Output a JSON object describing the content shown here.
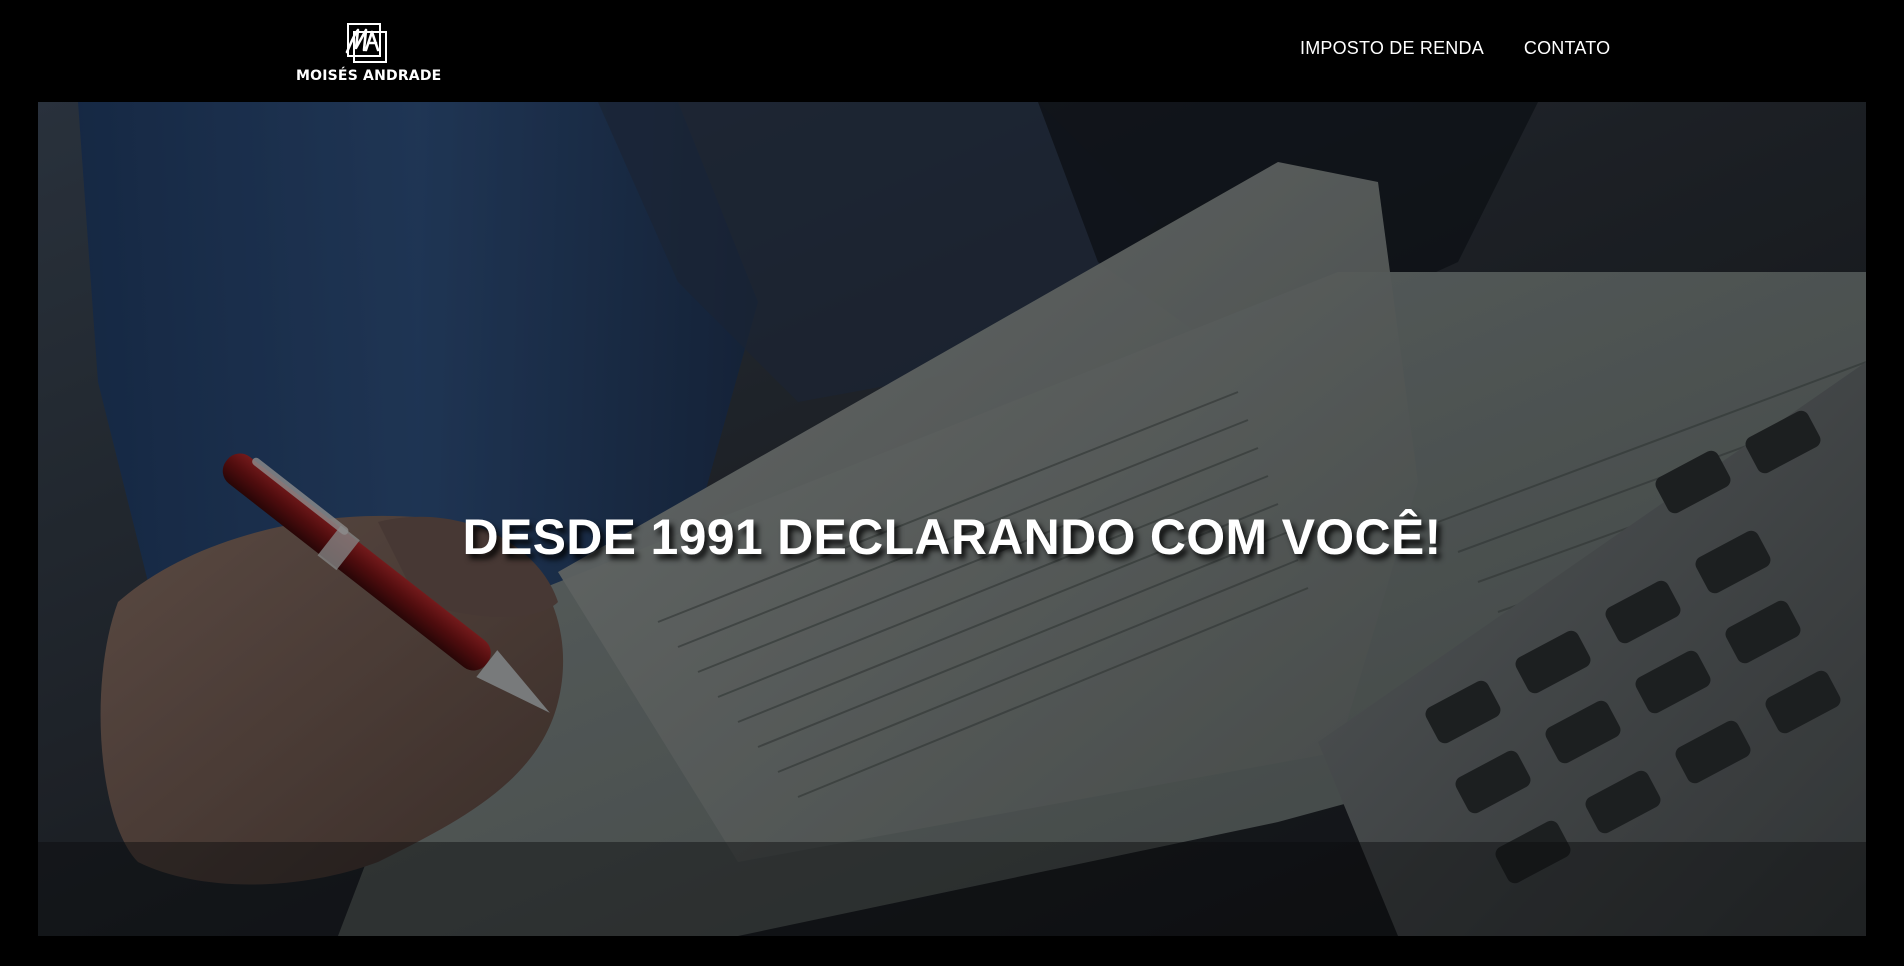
{
  "header": {
    "logo_text": "MOISÉS ANDRADE",
    "logo_monogram": "MA",
    "nav": [
      {
        "label": "IMPOSTO DE RENDA"
      },
      {
        "label": "CONTATO"
      }
    ]
  },
  "hero": {
    "title": "DESDE 1991 DECLARANDO COM VOCÊ!"
  },
  "colors": {
    "background": "#000000",
    "text": "#ffffff",
    "accent_pen": "#8a1a1c"
  }
}
